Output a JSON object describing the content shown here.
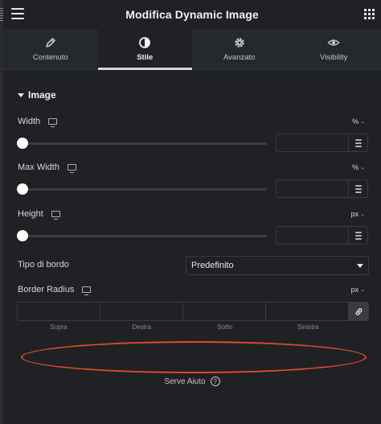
{
  "header": {
    "title": "Modifica Dynamic Image"
  },
  "tabs": [
    {
      "label": "Contenuto",
      "icon": "pencil-icon"
    },
    {
      "label": "Stile",
      "icon": "contrast-icon",
      "active": true
    },
    {
      "label": "Avanzato",
      "icon": "gear-icon"
    },
    {
      "label": "Visibility",
      "icon": "eye-icon"
    }
  ],
  "section": {
    "title": "Image"
  },
  "controls": {
    "width": {
      "label": "Width",
      "unit": "%",
      "value": ""
    },
    "max_width": {
      "label": "Max Width",
      "unit": "%",
      "value": ""
    },
    "height": {
      "label": "Height",
      "unit": "px",
      "value": ""
    },
    "border_type": {
      "label": "Tipo di bordo",
      "selected": "Predefinito"
    },
    "border_radius": {
      "label": "Border Radius",
      "unit": "px",
      "sides": [
        "Sopra",
        "Destra",
        "Sotto",
        "Sinistra"
      ]
    }
  },
  "help": {
    "label": "Serve Aiuto",
    "icon_text": "?"
  },
  "colors": {
    "accent": "#e0492c",
    "background": "#1f2124",
    "tab_bar": "#26292c"
  }
}
